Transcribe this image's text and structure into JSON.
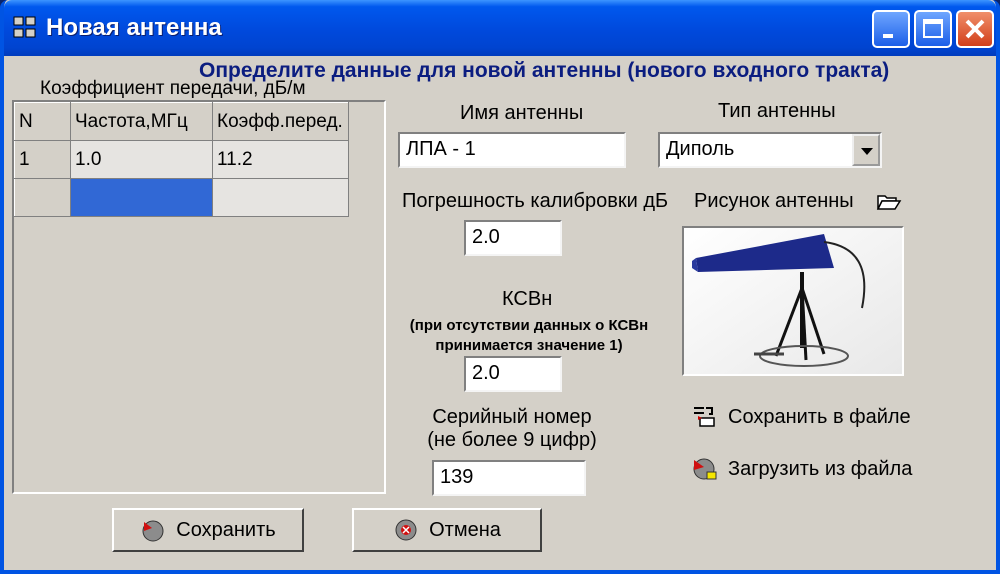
{
  "window": {
    "title": "Новая антенна"
  },
  "heading": "Определите данные для новой антенны (нового входного тракта)",
  "table": {
    "caption": "Коэффициент передачи, дБ/м",
    "columns": [
      "N",
      "Частота,МГц",
      "Коэфф.перед."
    ],
    "rows": [
      {
        "n": "1",
        "freq": "1.0",
        "coef": "11.2"
      }
    ]
  },
  "name": {
    "label": "Имя антенны",
    "value": "ЛПА - 1"
  },
  "type": {
    "label": "Тип антенны",
    "value": "Диполь"
  },
  "calibration": {
    "label": "Погрешность калибровки дБ",
    "value": "2.0"
  },
  "picture": {
    "label": "Рисунок антенны",
    "icon": "folder-open-icon"
  },
  "vswr": {
    "label": "КСВн",
    "note_line1": "(при отсутствии данных о КСВн",
    "note_line2": "принимается значение 1)",
    "value": "2.0"
  },
  "serial": {
    "label_line1": "Серийный номер",
    "label_line2": "(не более 9 цифр)",
    "value": "139"
  },
  "actions": {
    "save_file": "Сохранить в файле",
    "load_file": "Загрузить из файла"
  },
  "buttons": {
    "save": "Сохранить",
    "cancel": "Отмена"
  },
  "colors": {
    "titlebar": "#0054e3",
    "heading": "#0b1d80",
    "selection": "#3168d5",
    "dialog": "#d4d0c8"
  }
}
